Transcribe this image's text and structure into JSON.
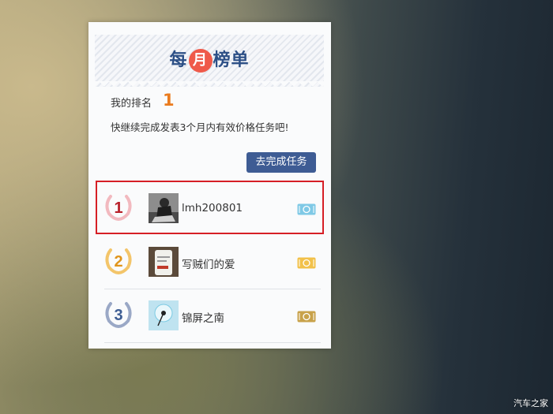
{
  "banner": {
    "title_left": "每",
    "title_mid": "月",
    "title_right": "榜单"
  },
  "my_rank": {
    "label": "我的排名",
    "value": "1"
  },
  "hint": "快继续完成发表3个月内有效价格任务吧!",
  "task_button": "去完成任务",
  "leaderboard": [
    {
      "rank": "1",
      "username": "lmh200801",
      "rank_color": "#b8202a",
      "wreath_color": "#f2b9bf",
      "ticket_color": "#7fc9e6",
      "ticket_icon": "ticket-icon"
    },
    {
      "rank": "2",
      "username": "写贼们的爱",
      "rank_color": "#e0951c",
      "wreath_color": "#f3c56a",
      "ticket_color": "#f2c14a",
      "ticket_icon": "ticket-icon"
    },
    {
      "rank": "3",
      "username": "锦屏之南",
      "rank_color": "#3d5d93",
      "wreath_color": "#9aa8c6",
      "ticket_color": "#c8a24a",
      "ticket_icon": "ticket-icon"
    }
  ],
  "watermark": "汽车之家",
  "colors": {
    "accent_blue": "#3e5c94",
    "highlight_red": "#d61f26",
    "rank_orange": "#ea7b1e",
    "title_circle": "#ef5a4a"
  }
}
